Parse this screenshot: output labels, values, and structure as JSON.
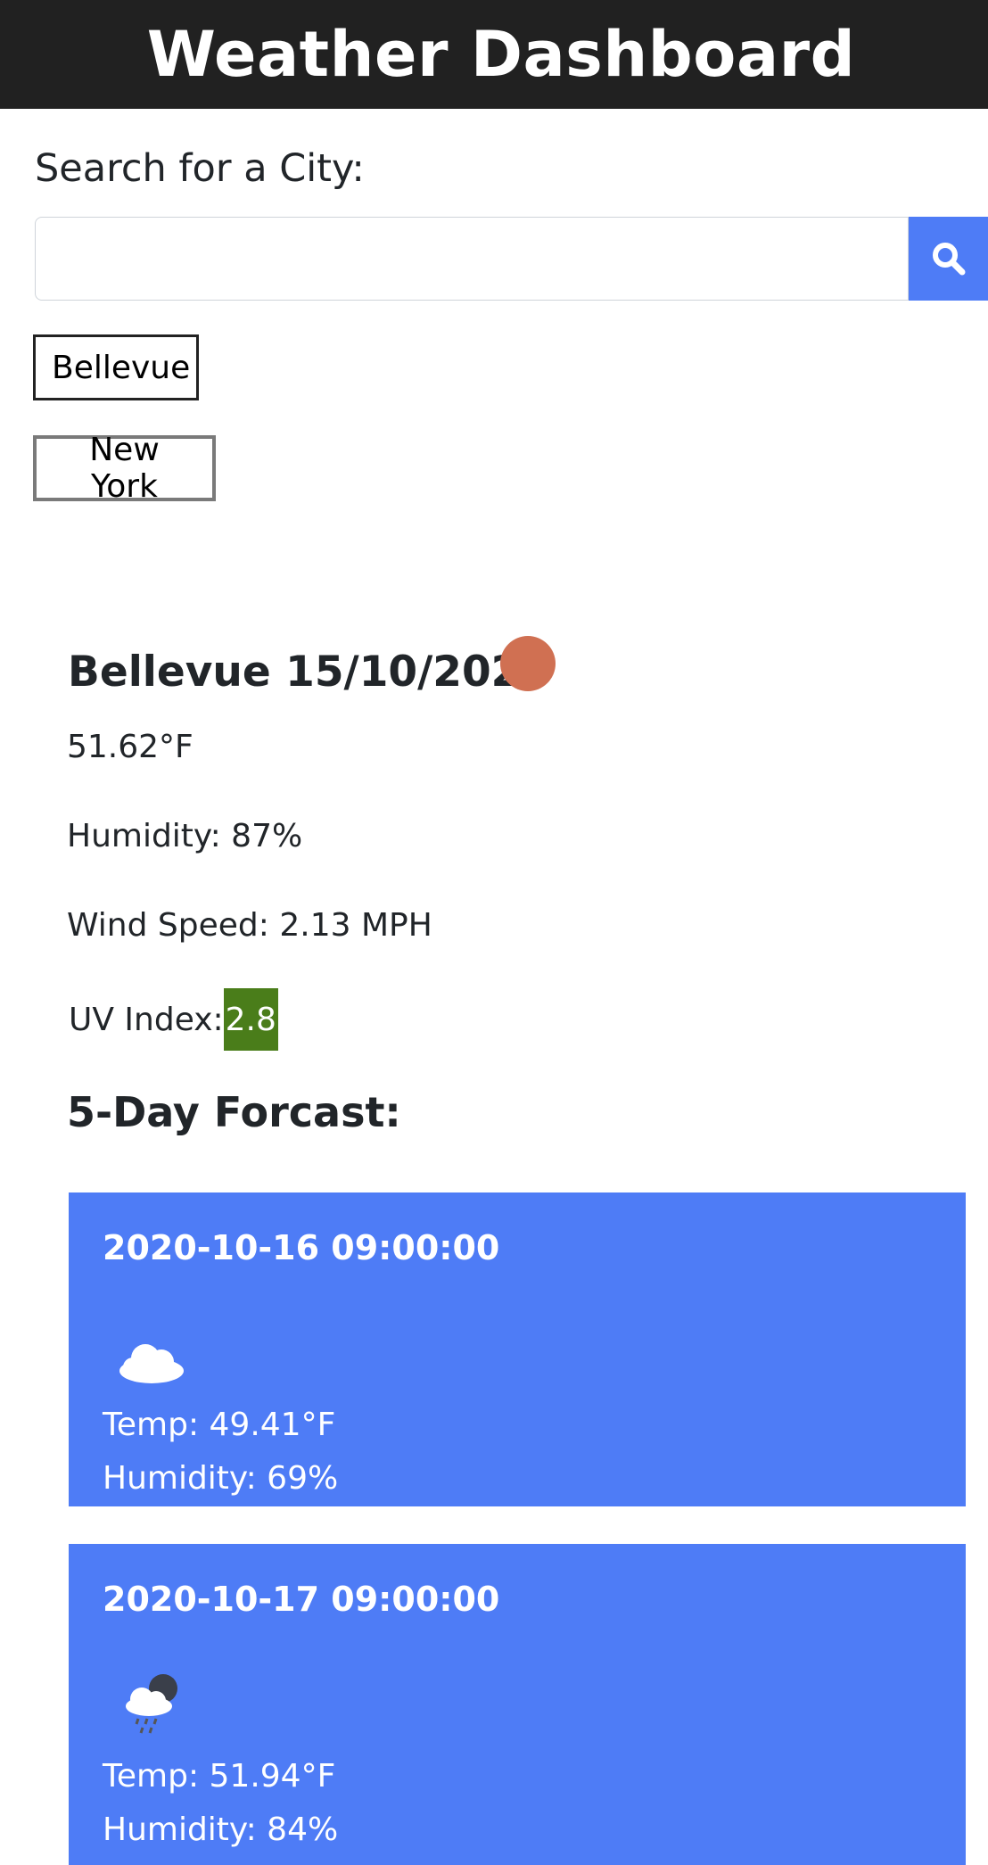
{
  "header": {
    "title": "Weather Dashboard"
  },
  "search": {
    "label": "Search for a City:",
    "input_value": "",
    "placeholder": "",
    "button_icon": "search-icon"
  },
  "history": [
    {
      "label": "Bellevue"
    },
    {
      "label": "New York"
    }
  ],
  "current": {
    "title": "Bellevue 15/10/2020",
    "icon": "sun-icon",
    "temperature": "51.62°F",
    "humidity": "Humidity: 87%",
    "wind": "Wind Speed: 2.13 MPH",
    "uv_label": "UV Index:",
    "uv_value": "2.8",
    "uv_color": "#4a7d1a"
  },
  "forecast": {
    "heading": "5-Day Forcast:",
    "accent_color": "#4e7cf6",
    "days": [
      {
        "date": "2020-10-16 09:00:00",
        "icon": "cloud-icon",
        "temp": "Temp: 49.41°F",
        "humidity": "Humidity: 69%"
      },
      {
        "date": "2020-10-17 09:00:00",
        "icon": "rain-night-icon",
        "temp": "Temp: 51.94°F",
        "humidity": "Humidity: 84%"
      }
    ]
  }
}
